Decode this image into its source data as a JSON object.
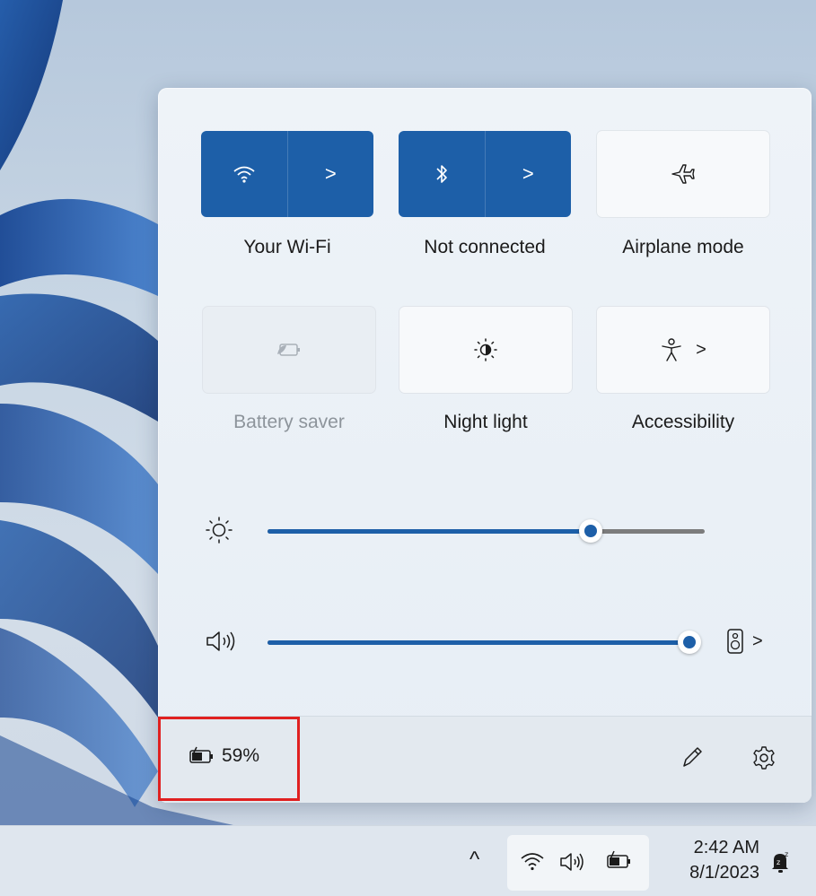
{
  "tiles": {
    "wifi": {
      "label": "Your Wi-Fi",
      "state": "on",
      "icon": "wifi-icon",
      "chevron": ">"
    },
    "bluetooth": {
      "label": "Not connected",
      "state": "on",
      "icon": "bluetooth-icon",
      "chevron": ">"
    },
    "airplane": {
      "label": "Airplane mode",
      "state": "off",
      "icon": "airplane-icon"
    },
    "battery_saver": {
      "label": "Battery saver",
      "state": "disabled",
      "icon": "battery-saver-icon"
    },
    "night_light": {
      "label": "Night light",
      "state": "off",
      "icon": "night-light-icon"
    },
    "accessibility": {
      "label": "Accessibility",
      "state": "off",
      "icon": "accessibility-icon",
      "chevron": ">"
    }
  },
  "sliders": {
    "brightness": {
      "icon": "brightness-icon",
      "level_percent": 74
    },
    "volume": {
      "icon": "speaker-icon",
      "level_percent": 100,
      "output_chevron": ">"
    }
  },
  "footer": {
    "battery_text": "59%",
    "battery_icon": "battery-charging-icon",
    "edit_icon": "pencil-icon",
    "settings_icon": "gear-icon"
  },
  "taskbar": {
    "time": "2:42 AM",
    "date": "8/1/2023",
    "overflow_chevron": "^"
  },
  "colors": {
    "accent": "#1d5fa8",
    "highlight": "#e02020"
  }
}
